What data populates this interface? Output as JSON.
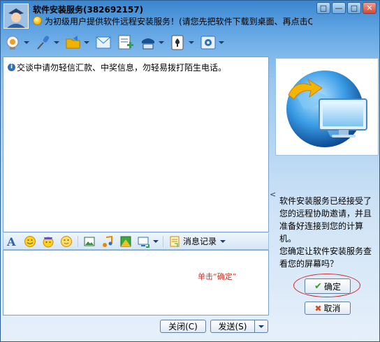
{
  "window": {
    "title": "软件安装服务(382692157)",
    "subtitle": "为初级用户提供软件远程安装服务！(请您先把软件下载到桌面、再点击QQ窗口“应用---",
    "controls": [
      "□",
      "—",
      "□",
      "✕"
    ]
  },
  "toolbar": {
    "items": [
      {
        "name": "video-icon",
        "color": "#f0a020"
      },
      {
        "name": "voice-icon",
        "color": "#3a7bd5"
      },
      {
        "name": "send-file-icon",
        "color": "#f0b400"
      },
      {
        "name": "email-icon",
        "color": "#2d7fcf"
      },
      {
        "name": "add-app-icon",
        "color": "#2aa54a"
      },
      {
        "name": "remote-assist-icon",
        "color": "#1c4f8f"
      },
      {
        "name": "games-icon",
        "color": "#2c2c2c"
      },
      {
        "name": "settings-icon",
        "color": "#2f6fbf"
      }
    ]
  },
  "chat": {
    "notice": "交谈中请勿轻信汇款、中奖信息，勿轻易拨打陌生电话。"
  },
  "format_bar": {
    "history_label": "消息记录"
  },
  "input": {
    "hint": "单击“确定”"
  },
  "buttons": {
    "close": "关闭(C)",
    "send": "发送(S)"
  },
  "right_panel": {
    "collapse_arrow": "<",
    "message_line1": "软件安装服务已经接受了",
    "message_line2": "您的远程协助邀请，并且",
    "message_line3": "准备好连接到您的计算",
    "message_line4": "机。",
    "message_line5": "您确定让软件安装服务查",
    "message_line6": "看您的屏幕吗？",
    "ok": "确定",
    "cancel": "取消"
  },
  "colors": {
    "accent": "#2d6fbf",
    "highlight_ring": "#d3242b",
    "hint_text": "#c0392b"
  }
}
